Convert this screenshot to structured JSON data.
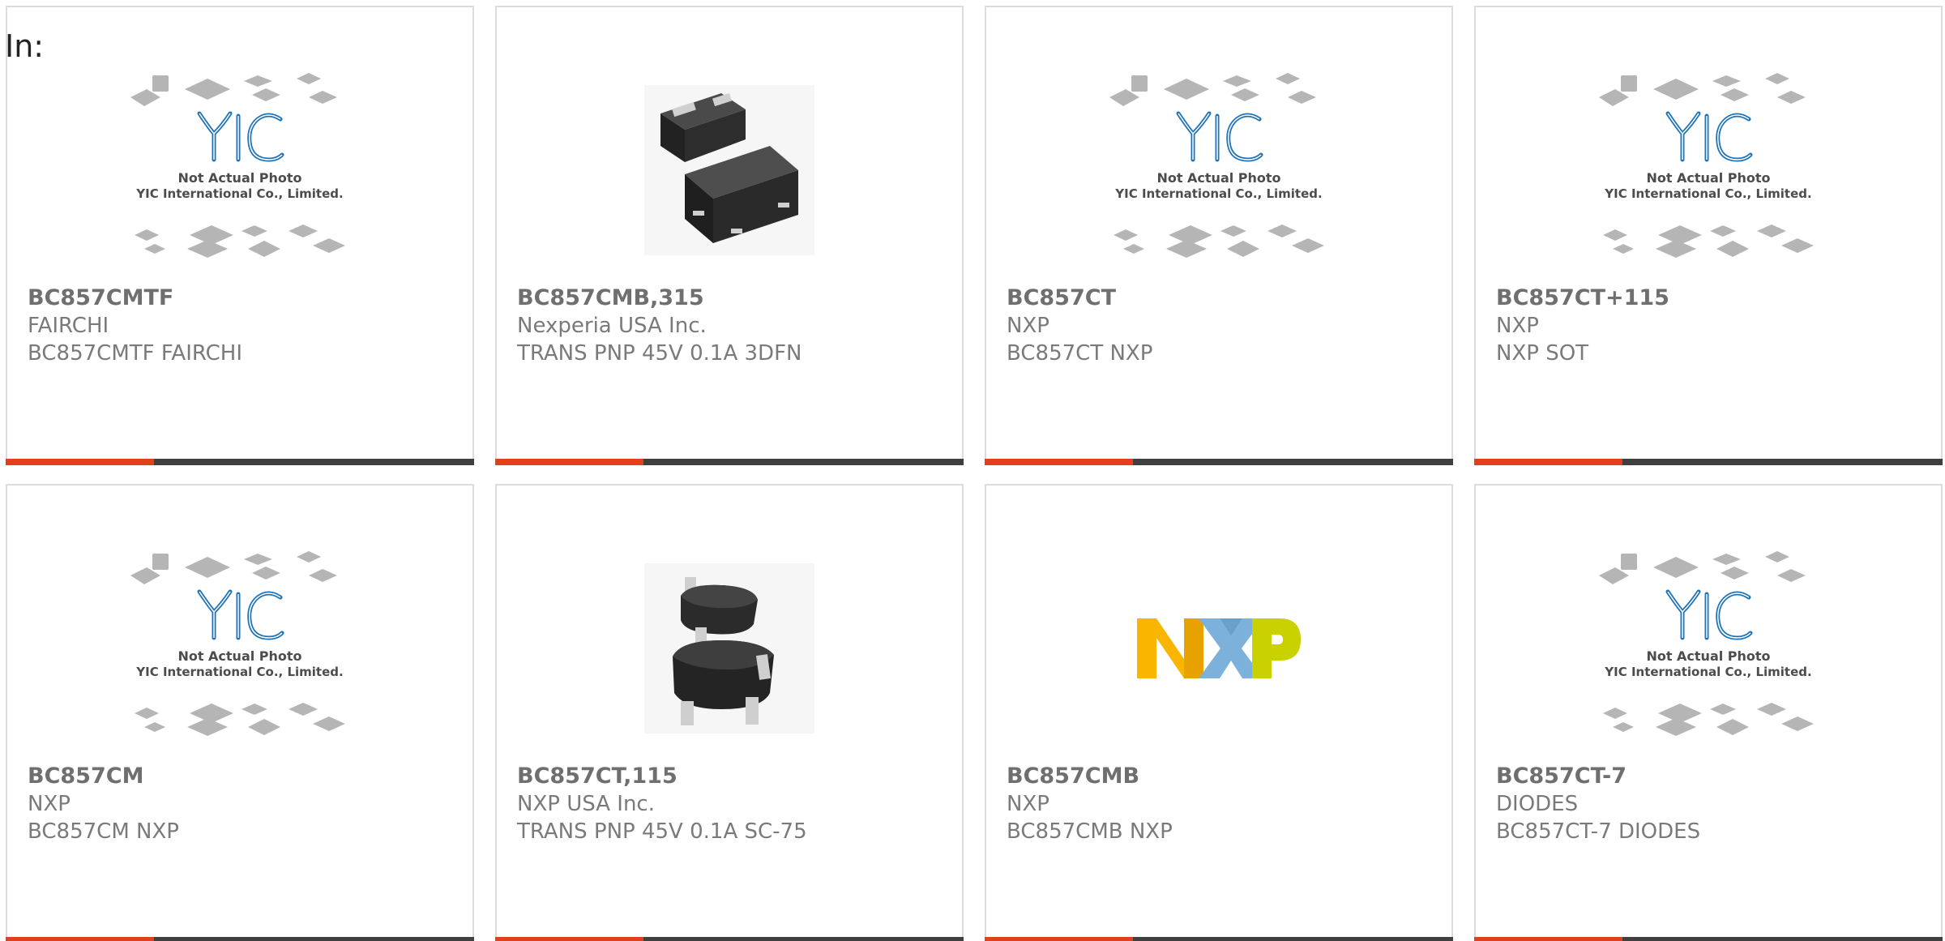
{
  "header": {
    "label": "In:"
  },
  "colors": {
    "accent": "#e2401c",
    "bar": "#3f3f3f",
    "text": "#6f6f6f",
    "border": "#dcdcdc"
  },
  "placeholder_image": {
    "line1": "Not Actual Photo",
    "line2": "YIC International Co., Limited."
  },
  "products": [
    {
      "part": "BC857CMTF",
      "manufacturer": "FAIRCHI",
      "description": "BC857CMTF FAIRCHI",
      "image": "placeholder"
    },
    {
      "part": "BC857CMB,315",
      "manufacturer": "Nexperia USA Inc.",
      "description": "TRANS PNP 45V 0.1A 3DFN",
      "image": "dfn-package-photo"
    },
    {
      "part": "BC857CT",
      "manufacturer": "NXP",
      "description": "BC857CT NXP",
      "image": "placeholder"
    },
    {
      "part": "BC857CT+115",
      "manufacturer": "NXP",
      "description": "NXP SOT",
      "image": "placeholder"
    },
    {
      "part": "BC857CM",
      "manufacturer": "NXP",
      "description": "BC857CM NXP",
      "image": "placeholder"
    },
    {
      "part": "BC857CT,115",
      "manufacturer": "NXP USA Inc.",
      "description": "TRANS PNP 45V 0.1A SC-75",
      "image": "sc75-package-photo"
    },
    {
      "part": "BC857CMB",
      "manufacturer": "NXP",
      "description": "BC857CMB NXP",
      "image": "nxp-logo"
    },
    {
      "part": "BC857CT-7",
      "manufacturer": "DIODES",
      "description": "BC857CT-7 DIODES",
      "image": "placeholder"
    }
  ]
}
